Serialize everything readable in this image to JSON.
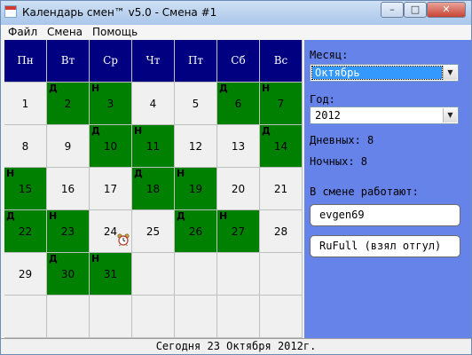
{
  "window": {
    "title": "Календарь смен™ v5.0 - Смена #1",
    "minimize_label": "–",
    "maximize_label": "□",
    "close_label": "✕"
  },
  "menu": [
    "Файл",
    "Смена",
    "Помощь"
  ],
  "calendar": {
    "weekdays": [
      "Пн",
      "Вт",
      "Ср",
      "Чт",
      "Пт",
      "Сб",
      "Вс"
    ],
    "rows": [
      [
        {
          "day": "1",
          "tag": "",
          "shift": false
        },
        {
          "day": "2",
          "tag": "Д",
          "shift": true
        },
        {
          "day": "3",
          "tag": "Н",
          "shift": true
        },
        {
          "day": "4",
          "tag": "",
          "shift": false
        },
        {
          "day": "5",
          "tag": "",
          "shift": false
        },
        {
          "day": "6",
          "tag": "Д",
          "shift": true
        },
        {
          "day": "7",
          "tag": "Н",
          "shift": true
        }
      ],
      [
        {
          "day": "8",
          "tag": "",
          "shift": false
        },
        {
          "day": "9",
          "tag": "",
          "shift": false
        },
        {
          "day": "10",
          "tag": "Д",
          "shift": true
        },
        {
          "day": "11",
          "tag": "Н",
          "shift": true
        },
        {
          "day": "12",
          "tag": "",
          "shift": false
        },
        {
          "day": "13",
          "tag": "",
          "shift": false
        },
        {
          "day": "14",
          "tag": "Д",
          "shift": true
        }
      ],
      [
        {
          "day": "15",
          "tag": "Н",
          "shift": true
        },
        {
          "day": "16",
          "tag": "",
          "shift": false
        },
        {
          "day": "17",
          "tag": "",
          "shift": false
        },
        {
          "day": "18",
          "tag": "Д",
          "shift": true
        },
        {
          "day": "19",
          "tag": "Н",
          "shift": true
        },
        {
          "day": "20",
          "tag": "",
          "shift": false
        },
        {
          "day": "21",
          "tag": "",
          "shift": false
        }
      ],
      [
        {
          "day": "22",
          "tag": "Д",
          "shift": true
        },
        {
          "day": "23",
          "tag": "Н",
          "shift": true
        },
        {
          "day": "24",
          "tag": "",
          "shift": false,
          "alarm": true
        },
        {
          "day": "25",
          "tag": "",
          "shift": false
        },
        {
          "day": "26",
          "tag": "Д",
          "shift": true
        },
        {
          "day": "27",
          "tag": "Н",
          "shift": true
        },
        {
          "day": "28",
          "tag": "",
          "shift": false
        }
      ],
      [
        {
          "day": "29",
          "tag": "",
          "shift": false
        },
        {
          "day": "30",
          "tag": "Д",
          "shift": true
        },
        {
          "day": "31",
          "tag": "Н",
          "shift": true
        },
        {
          "day": "",
          "tag": "",
          "shift": false
        },
        {
          "day": "",
          "tag": "",
          "shift": false
        },
        {
          "day": "",
          "tag": "",
          "shift": false
        },
        {
          "day": "",
          "tag": "",
          "shift": false
        }
      ],
      [
        {
          "day": "",
          "tag": "",
          "shift": false
        },
        {
          "day": "",
          "tag": "",
          "shift": false
        },
        {
          "day": "",
          "tag": "",
          "shift": false
        },
        {
          "day": "",
          "tag": "",
          "shift": false
        },
        {
          "day": "",
          "tag": "",
          "shift": false
        },
        {
          "day": "",
          "tag": "",
          "shift": false
        },
        {
          "day": "",
          "tag": "",
          "shift": false
        }
      ]
    ]
  },
  "panel": {
    "month_label": "Месяц:",
    "month_value": "Октябрь",
    "year_label": "Год:",
    "year_value": "2012",
    "day_count": "Дневных: 8",
    "night_count": "Ночных: 8",
    "workers_label": "В смене работают:",
    "workers": [
      "evgen69",
      "RuFull (взял отгул)"
    ]
  },
  "status": "Сегодня 23 Октября 2012г.",
  "colors": {
    "header_bg": "#000080",
    "shift_cell": "#008000",
    "empty_cell": "#f0f0f0",
    "panel_bg": "#6683ea",
    "selection": "#3399ff"
  }
}
